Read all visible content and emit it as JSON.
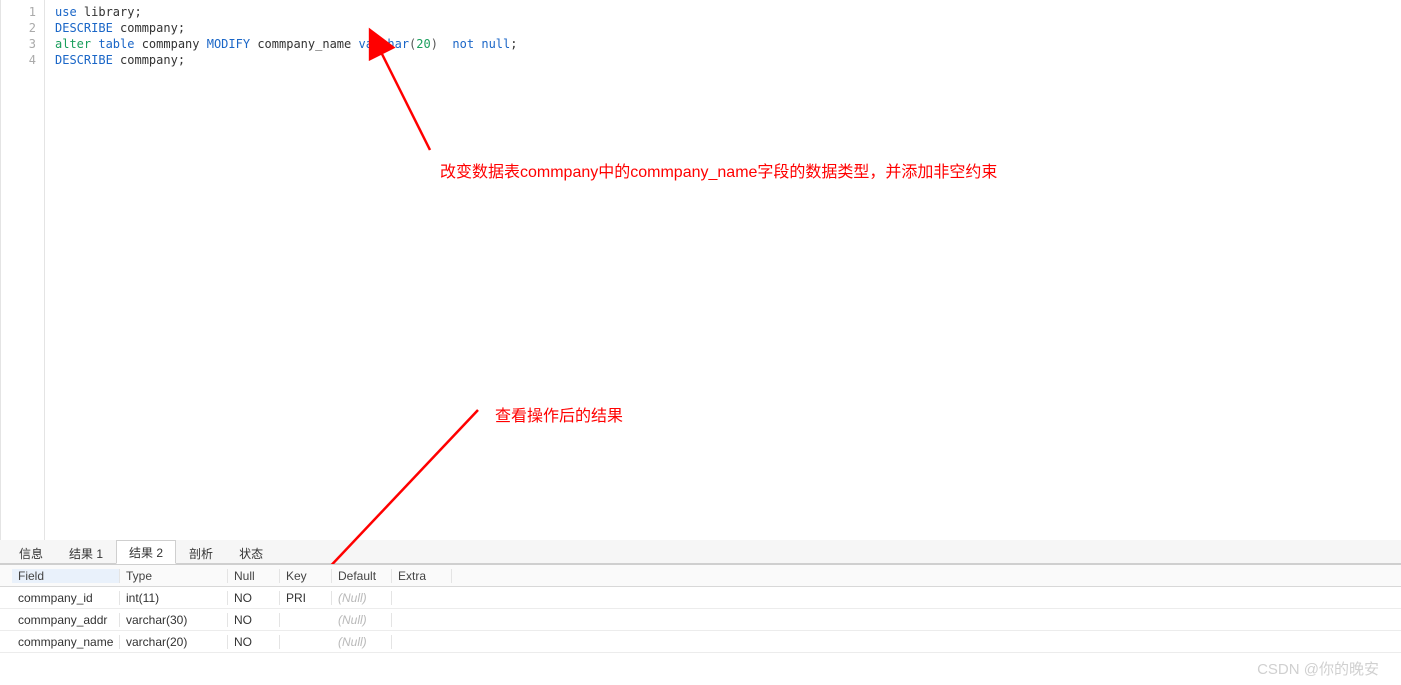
{
  "editor": {
    "lines": [
      [
        {
          "t": "use",
          "c": "kw-blue"
        },
        {
          "t": " library;",
          "c": "kw-black"
        }
      ],
      [
        {
          "t": "DESCRIBE",
          "c": "kw-blue"
        },
        {
          "t": " commpany;",
          "c": "kw-black"
        }
      ],
      [
        {
          "t": "alter",
          "c": "kw-green"
        },
        {
          "t": " ",
          "c": "kw-black"
        },
        {
          "t": "table",
          "c": "kw-blue"
        },
        {
          "t": " commpany ",
          "c": "kw-black"
        },
        {
          "t": "MODIFY",
          "c": "kw-blue"
        },
        {
          "t": " commpany_name ",
          "c": "kw-black"
        },
        {
          "t": "varchar",
          "c": "kw-blue"
        },
        {
          "t": "(",
          "c": "kw-gray"
        },
        {
          "t": "20",
          "c": "kw-green"
        },
        {
          "t": ")  ",
          "c": "kw-gray"
        },
        {
          "t": "not",
          "c": "kw-blue"
        },
        {
          "t": " ",
          "c": "kw-black"
        },
        {
          "t": "null",
          "c": "kw-blue"
        },
        {
          "t": ";",
          "c": "kw-black"
        }
      ],
      [
        {
          "t": "DESCRIBE",
          "c": "kw-blue"
        },
        {
          "t": " commpany;",
          "c": "kw-black"
        }
      ]
    ],
    "lineNumbers": [
      "1",
      "2",
      "3",
      "4"
    ]
  },
  "annotations": {
    "a1_text": "改变数据表commpany中的commpany_name字段的数据类型，并添加非空约束",
    "a2_text": "查看操作后的结果"
  },
  "tabs": {
    "items": [
      {
        "label": "信息",
        "active": false
      },
      {
        "label": "结果 1",
        "active": false
      },
      {
        "label": "结果 2",
        "active": true
      },
      {
        "label": "剖析",
        "active": false
      },
      {
        "label": "状态",
        "active": false
      }
    ]
  },
  "grid": {
    "columns": {
      "field": "Field",
      "type": "Type",
      "null": "Null",
      "key": "Key",
      "default": "Default",
      "extra": "Extra"
    },
    "rows": [
      {
        "field": "commpany_id",
        "type": "int(11)",
        "null": "NO",
        "key": "PRI",
        "default": "(Null)",
        "extra": "",
        "selected": true
      },
      {
        "field": "commpany_addr",
        "type": "varchar(30)",
        "null": "NO",
        "key": "",
        "default": "(Null)",
        "extra": "",
        "selected": false
      },
      {
        "field": "commpany_name",
        "type": "varchar(20)",
        "null": "NO",
        "key": "",
        "default": "(Null)",
        "extra": "",
        "selected": false
      }
    ]
  },
  "watermark": "CSDN @你的晚安"
}
